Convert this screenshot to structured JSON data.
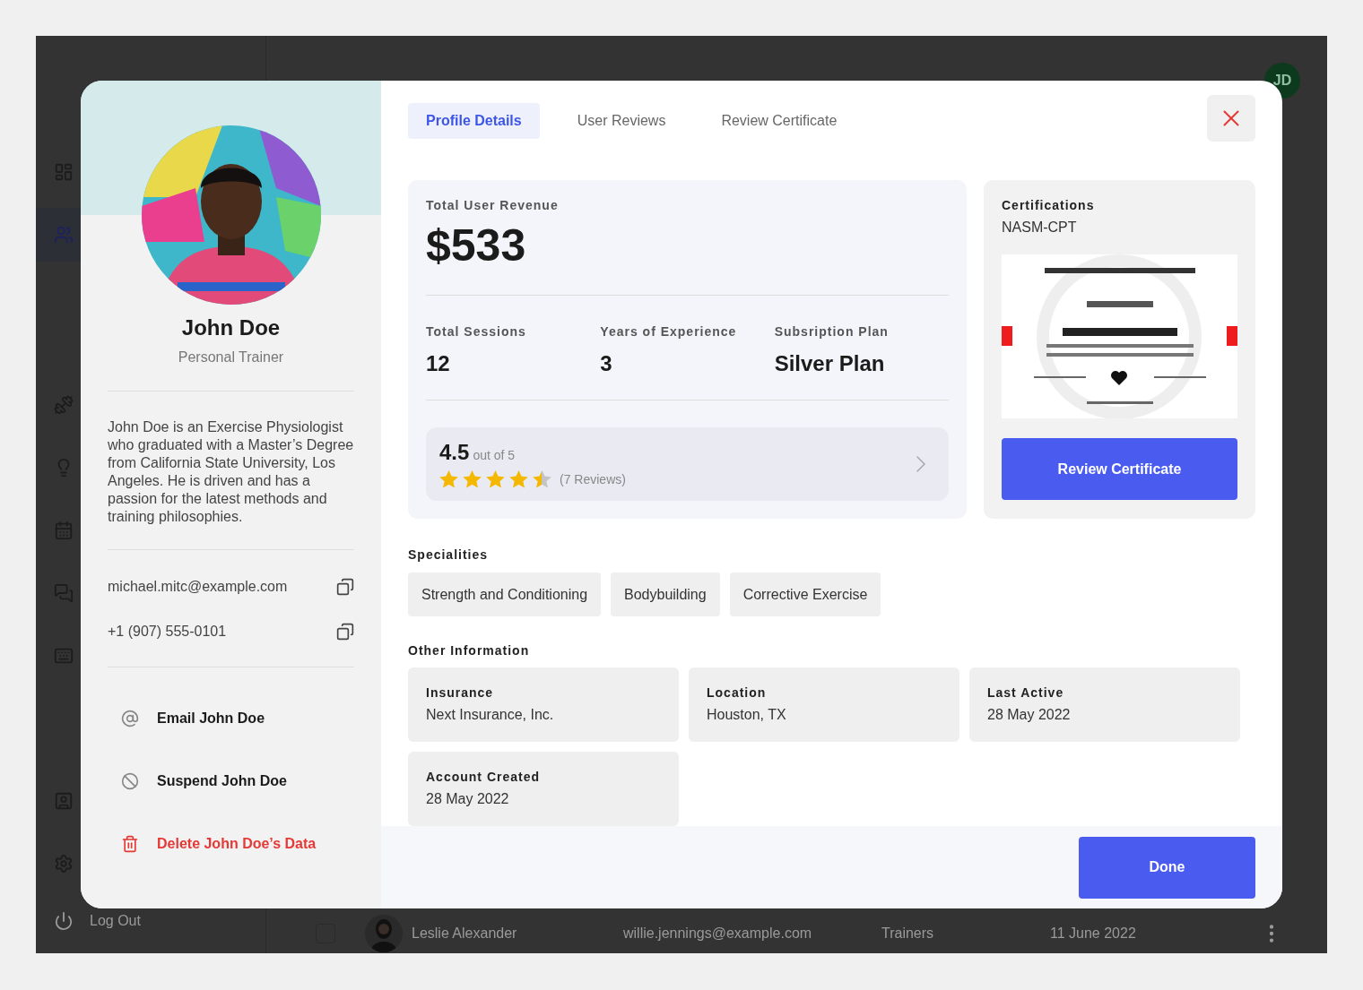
{
  "app": {
    "nav_groups": [
      [
        {
          "kind": "dashboard",
          "selected": false
        },
        {
          "kind": "users",
          "selected": true
        }
      ],
      [
        {
          "kind": "dumbbell",
          "selected": false
        },
        {
          "kind": "lightbulb",
          "selected": false
        },
        {
          "kind": "calendar",
          "selected": false
        },
        {
          "kind": "chat",
          "selected": false
        },
        {
          "kind": "keyboard",
          "selected": false
        }
      ],
      [
        {
          "kind": "contact",
          "selected": false
        },
        {
          "kind": "settings",
          "selected": false
        }
      ]
    ],
    "logout": "Log Out",
    "avatar": "JD",
    "row": {
      "checked": false,
      "name": "Leslie Alexander",
      "email": "willie.jennings@example.com",
      "role": "Trainers",
      "date": "11 June 2022"
    }
  },
  "profile": {
    "name": "John Doe",
    "role": "Personal Trainer",
    "bio": "John Doe is an Exercise Physiologist who graduated with a Master’s Degree from California State University, Los Angeles. He is driven and has a passion for the latest methods and training philosophies.",
    "contacts": [
      "michael.mitc@example.com",
      "+1 (907) 555-0101"
    ],
    "actions": [
      {
        "kind": "email",
        "label": "Email John Doe"
      },
      {
        "kind": "suspend",
        "label": "Suspend John Doe"
      },
      {
        "kind": "delete",
        "label": "Delete John Doe’s Data"
      }
    ]
  },
  "tabs": [
    {
      "label": "Profile Details",
      "selected": true
    },
    {
      "label": "User Reviews",
      "selected": false
    },
    {
      "label": "Review Certificate",
      "selected": false
    }
  ],
  "stats": {
    "revenue_label": "Total User Revenue",
    "revenue": "$533",
    "items": [
      {
        "label": "Total Sessions",
        "value": "12"
      },
      {
        "label": "Years of Experience",
        "value": "3"
      },
      {
        "label": "Subsription Plan",
        "value": "Silver Plan"
      }
    ]
  },
  "rating": {
    "score": "4.5",
    "out_of": "out of 5",
    "stars": 4.5,
    "count": "(7 Reviews)"
  },
  "certifications": {
    "title": "Certifications",
    "name": "NASM-CPT",
    "button": "Review Certificate"
  },
  "specialities": {
    "title": "Specialities",
    "items": [
      "Strength and Conditioning",
      "Bodybuilding",
      "Corrective Exercise"
    ]
  },
  "other": {
    "title": "Other Information",
    "items": [
      {
        "label": "Insurance",
        "value": "Next Insurance, Inc."
      },
      {
        "label": "Location",
        "value": "Houston, TX"
      },
      {
        "label": "Last Active",
        "value": "28 May 2022"
      },
      {
        "label": "Account Created",
        "value": "28 May 2022"
      }
    ]
  },
  "done": "Done"
}
